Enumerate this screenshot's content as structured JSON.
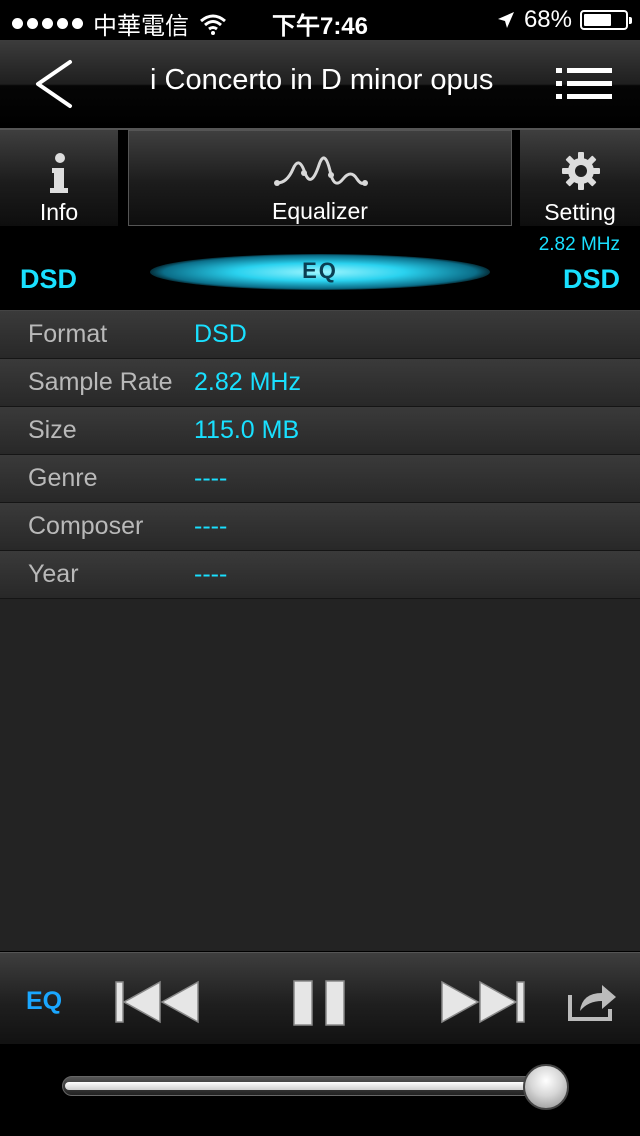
{
  "status_bar": {
    "carrier": "中華電信",
    "time": "下午7:46",
    "battery": "68%",
    "battery_level": 0.68,
    "icons": [
      "signal-dots-icon",
      "wifi-icon",
      "location-arrow-icon",
      "battery-icon"
    ]
  },
  "nav": {
    "title": "i Concerto in D minor opus",
    "back_icon": "chevron-left-icon",
    "list_icon": "list-icon"
  },
  "tabs": [
    {
      "label": "Info",
      "icon": "info-icon"
    },
    {
      "label": "Equalizer",
      "icon": "waveform-icon"
    },
    {
      "label": "Setting",
      "icon": "gear-icon"
    }
  ],
  "eq_strip": {
    "left_format": "DSD",
    "right_format": "DSD",
    "frequency": "2.82 MHz",
    "eq_label": "EQ"
  },
  "info_rows": [
    {
      "key": "Format",
      "value": "DSD"
    },
    {
      "key": "Sample Rate",
      "value": "2.82 MHz"
    },
    {
      "key": "Size",
      "value": "115.0 MB"
    },
    {
      "key": "Genre",
      "value": "----"
    },
    {
      "key": "Composer",
      "value": "----"
    },
    {
      "key": "Year",
      "value": "----"
    }
  ],
  "controls": {
    "eq_label": "EQ",
    "icons": [
      "skip-back-icon",
      "pause-icon",
      "skip-forward-icon",
      "share-icon"
    ]
  },
  "progress": {
    "fraction": 0.96
  },
  "colors": {
    "accent": "#19e0ff",
    "eq_button": "#1aa7ff",
    "label_gray": "#b9b9b9"
  }
}
